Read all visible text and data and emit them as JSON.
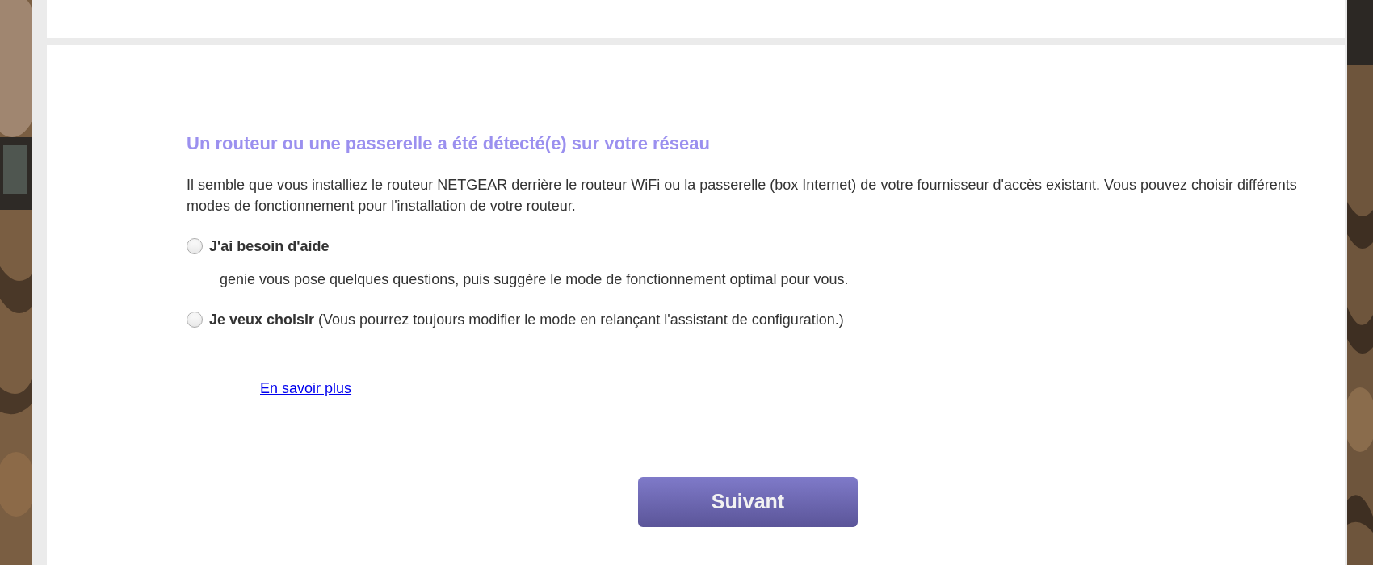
{
  "heading": "Un routeur ou une passerelle a été détecté(e) sur votre réseau",
  "intro": "Il semble que vous installiez le routeur NETGEAR derrière le routeur WiFi ou la passerelle (box Internet) de votre fournisseur d'accès existant. Vous pouvez choisir différents modes de fonctionnement pour l'installation de votre routeur.",
  "options": [
    {
      "label": "J'ai besoin d'aide",
      "description": "genie vous pose quelques questions, puis suggère le mode de fonctionnement optimal pour vous.",
      "selected": false
    },
    {
      "label": "Je veux choisir",
      "note": "(Vous pourrez toujours modifier le mode en relançant l'assistant de configuration.)",
      "selected": false
    }
  ],
  "link": "En savoir plus",
  "button": "Suivant"
}
